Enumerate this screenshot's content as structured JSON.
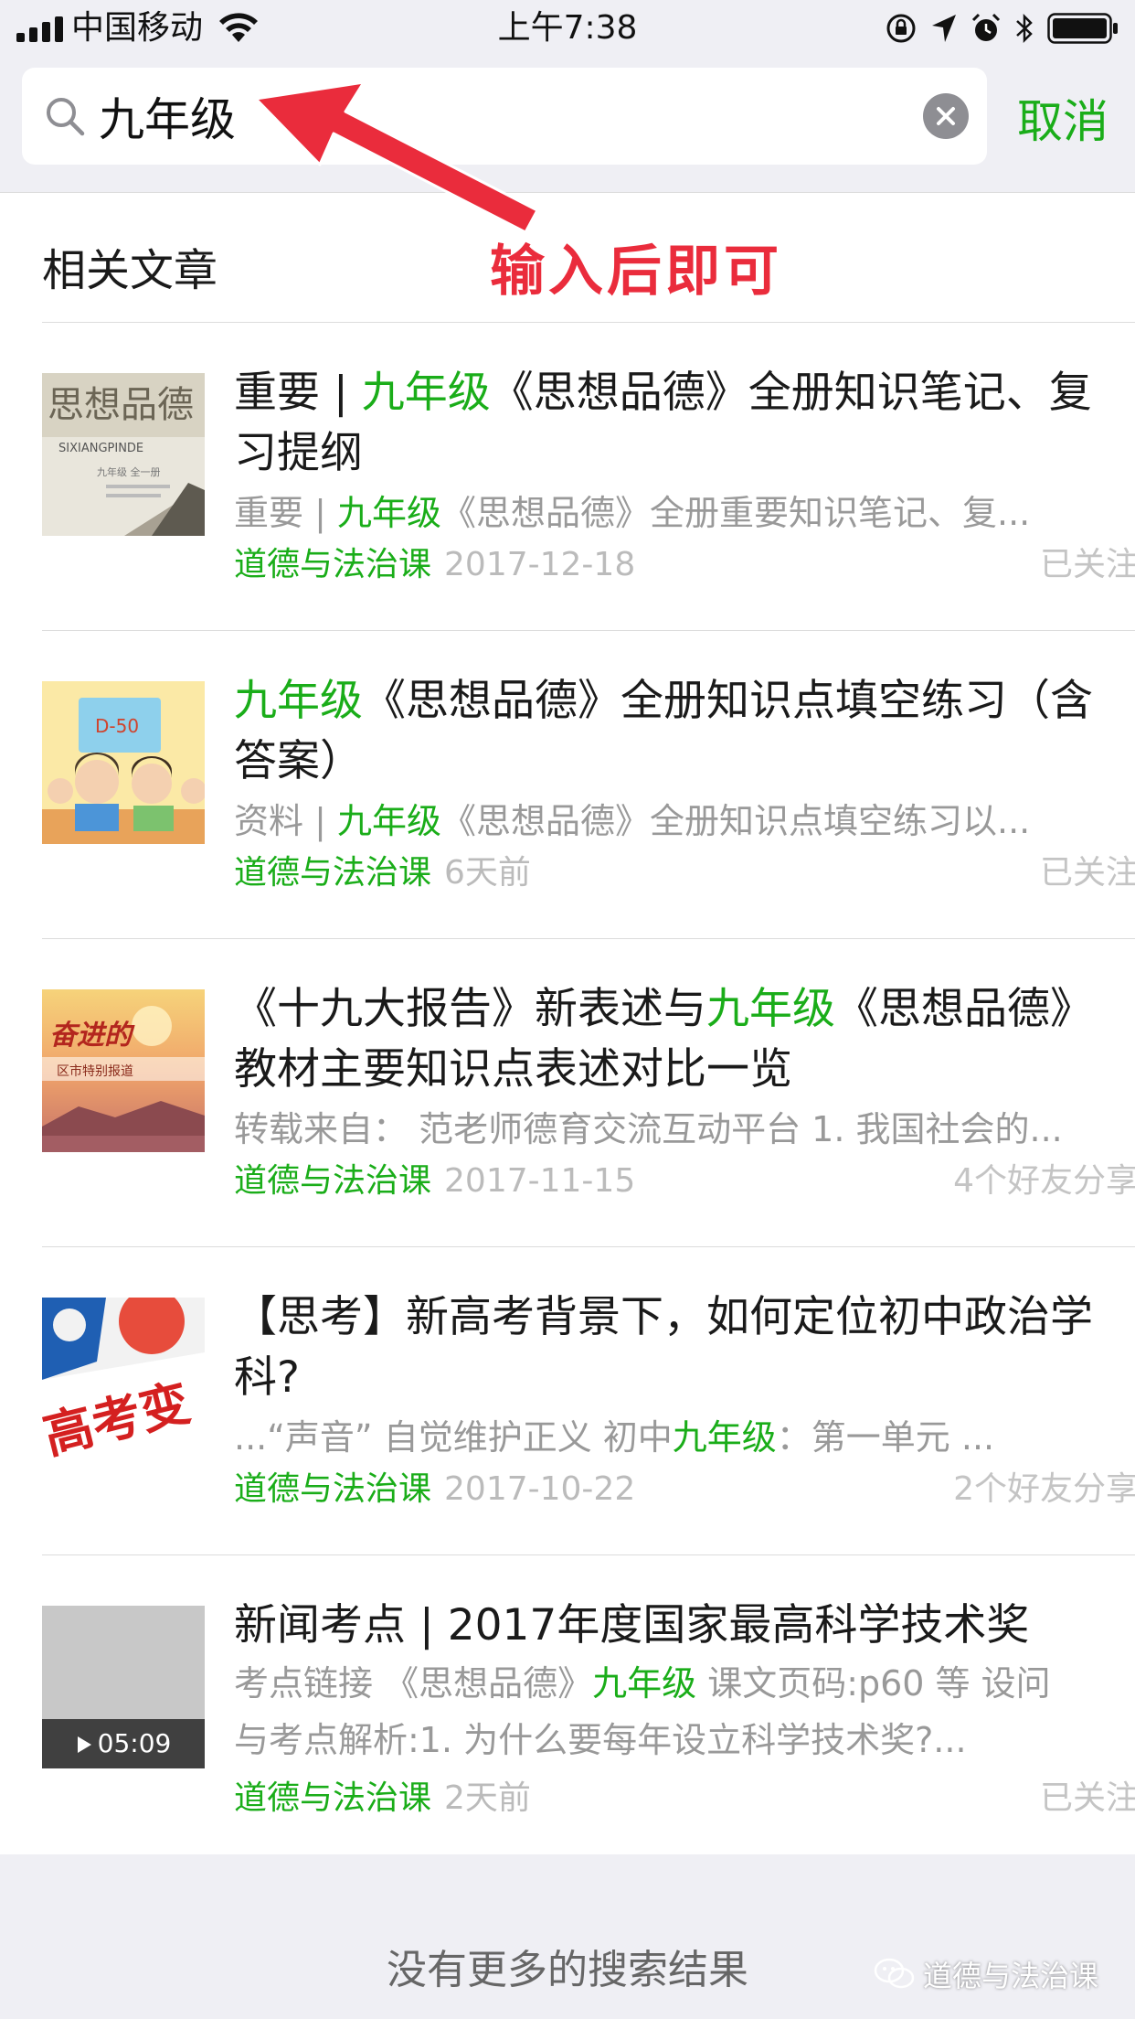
{
  "status_bar": {
    "carrier": "中国移动",
    "time": "上午7:38"
  },
  "search": {
    "query": "九年级",
    "cancel_label": "取消"
  },
  "annotation": {
    "callout": "输入后即可"
  },
  "section": {
    "title": "相关文章"
  },
  "results": [
    {
      "title": [
        "重要 | ",
        "九年级",
        "《思想品德》全册知识笔记、复习提纲"
      ],
      "snippet": [
        "重要 | ",
        "九年级",
        "《思想品德》全册重要知识笔记、复..."
      ],
      "source": "道德与法治课",
      "date": "2017-12-18",
      "status": "已关注",
      "thumb_label": [
        "思想品德",
        "SIXIANGPINDE",
        "九年级 全一册"
      ]
    },
    {
      "title": [
        "",
        "九年级",
        "《思想品德》全册知识点填空练习（含答案）"
      ],
      "snippet": [
        "资料 | ",
        "九年级",
        "《思想品德》全册知识点填空练习以..."
      ],
      "source": "道德与法治课",
      "date": "6天前",
      "status": "已关注",
      "thumb_label": [
        "D-50"
      ]
    },
    {
      "title": [
        "《十九大报告》新表述与",
        "九年级",
        "《思想品德》教材主要知识点表述对比一览"
      ],
      "snippet": [
        "转载来自：  范老师德育交流互动平台 1. 我国社会的...",
        "",
        ""
      ],
      "source": "道德与法治课",
      "date": "2017-11-15",
      "status": "4个好友分享",
      "thumb_label": [
        "奋进的",
        "区市特别报道"
      ]
    },
    {
      "title": [
        "【思考】新高考背景下，如何定位初中政治学科?",
        "",
        ""
      ],
      "snippet": [
        "...“声音” 自觉维护正义 初中",
        "九年级",
        "：第一单元 ..."
      ],
      "source": "道德与法治课",
      "date": "2017-10-22",
      "status": "2个好友分享",
      "thumb_label": [
        "高考变"
      ]
    },
    {
      "title": [
        "新闻考点 | 2017年度国家最高科学技术奖",
        "",
        ""
      ],
      "snippet": [
        "考点链接 《思想品德》",
        "九年级",
        " 课文页码:p60 等 设问"
      ],
      "snippet2": "与考点解析:1. 为什么要每年设立科学技术奖?...",
      "source": "道德与法治课",
      "date": "2天前",
      "status": "已关注",
      "duration": "05:09"
    }
  ],
  "footer": {
    "no_more": "没有更多的搜索结果",
    "watermark": "道德与法治课"
  },
  "colors": {
    "accent": "#1aad19",
    "annotation": "#ea2c3c",
    "header_bg": "#efeff4"
  },
  "icons": [
    "signal-icon",
    "wifi-icon",
    "orientation-lock-icon",
    "location-icon",
    "alarm-icon",
    "bluetooth-icon",
    "battery-icon",
    "search-icon",
    "clear-icon",
    "play-icon",
    "wechat-icon"
  ]
}
